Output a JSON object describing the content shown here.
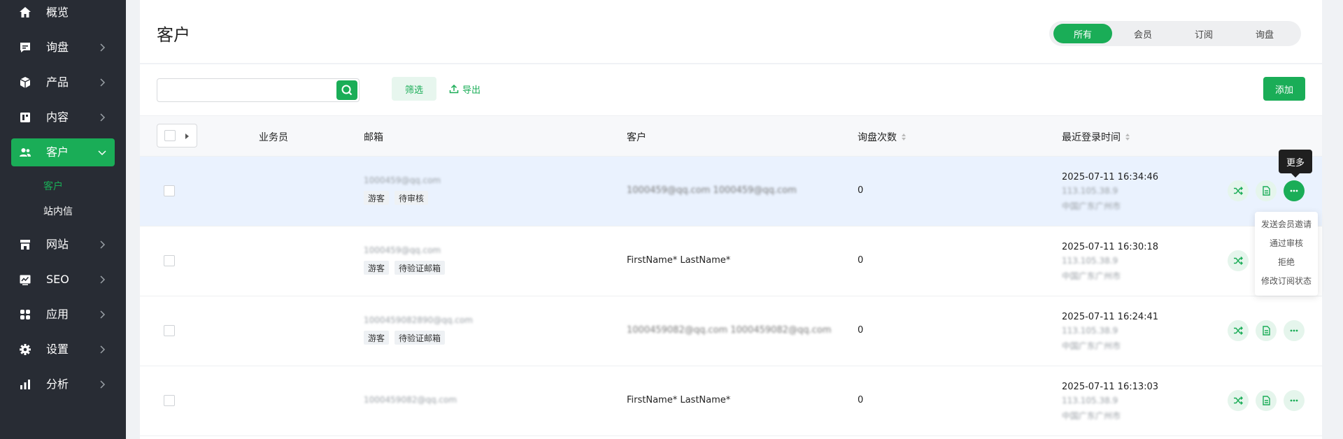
{
  "sidebar": {
    "items": [
      {
        "label": "概览",
        "icon": "home-icon"
      },
      {
        "label": "询盘",
        "icon": "message-icon"
      },
      {
        "label": "产品",
        "icon": "cube-icon"
      },
      {
        "label": "内容",
        "icon": "content-icon"
      },
      {
        "label": "客户",
        "icon": "users-icon"
      },
      {
        "label": "网站",
        "icon": "store-icon"
      },
      {
        "label": "SEO",
        "icon": "seo-icon"
      },
      {
        "label": "应用",
        "icon": "apps-icon"
      },
      {
        "label": "设置",
        "icon": "gear-icon"
      },
      {
        "label": "分析",
        "icon": "bar-chart-icon"
      }
    ],
    "sub_items": [
      "客户",
      "站内信"
    ]
  },
  "header": {
    "title": "客户",
    "tabs": [
      "所有",
      "会员",
      "订阅",
      "询盘"
    ]
  },
  "toolbar": {
    "search_placeholder": "",
    "filter_label": "筛选",
    "export_label": "导出",
    "add_label": "添加"
  },
  "table": {
    "columns": [
      "业务员",
      "邮箱",
      "客户",
      "询盘次数",
      "最近登录时间"
    ],
    "rows": [
      {
        "email": "1000459@qq.com",
        "tags": [
          "游客",
          "待审核"
        ],
        "customer": "1000459@qq.com 1000459@qq.com",
        "count": "0",
        "time": "2025-07-11 16:34:46",
        "ip": "113.105.38.9",
        "location": "中国广东广州市"
      },
      {
        "email": "1000459@qq.com",
        "tags": [
          "游客",
          "待验证邮箱"
        ],
        "customer": "FirstName* LastName*",
        "count": "0",
        "time": "2025-07-11 16:30:18",
        "ip": "113.105.38.9",
        "location": "中国广东广州市"
      },
      {
        "email": "1000459082890@qq.com",
        "tags": [
          "游客",
          "待验证邮箱"
        ],
        "customer": "1000459082@qq.com 1000459082@qq.com",
        "count": "0",
        "time": "2025-07-11 16:24:41",
        "ip": "113.105.38.9",
        "location": "中国广东广州市"
      },
      {
        "email": "1000459082@qq.com",
        "tags": [],
        "customer": "FirstName* LastName*",
        "count": "0",
        "time": "2025-07-11 16:13:03",
        "ip": "113.105.38.9",
        "location": "中国广东广州市"
      }
    ]
  },
  "tooltip": {
    "more": "更多"
  },
  "more_menu": [
    "发送会员邀请",
    "通过审核",
    "拒绝",
    "修改订阅状态"
  ],
  "colors": {
    "accent": "#1aad57",
    "sidebar_bg": "#282c34",
    "row_highlight": "#eaf2fe"
  }
}
